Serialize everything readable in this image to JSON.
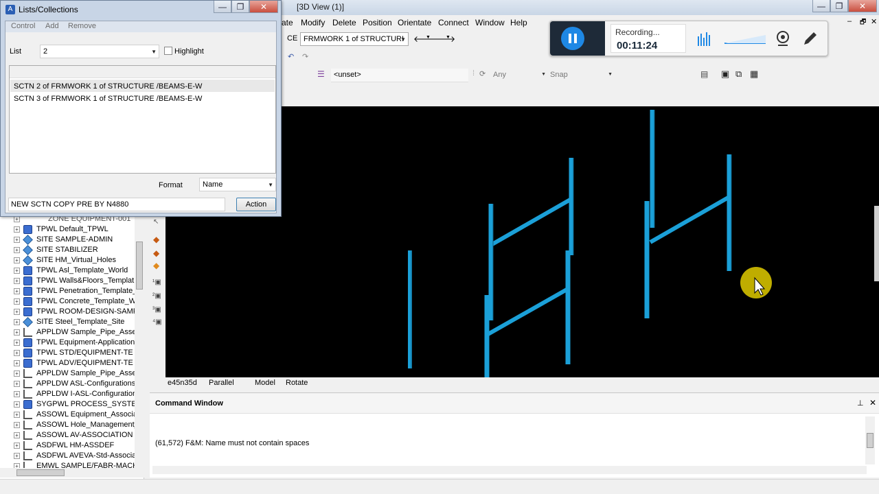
{
  "main_window": {
    "title": "[3D View (1)]",
    "controls": {
      "minimize": "—",
      "restore": "❐",
      "close": "✕"
    },
    "inner_controls": {
      "minimize": "–",
      "restore": "🗗",
      "close": "✕"
    }
  },
  "menu": [
    "ate",
    "Modify",
    "Delete",
    "Position",
    "Orientate",
    "Connect",
    "Window",
    "Help"
  ],
  "toolbar": {
    "ce_label": "CE",
    "ce_value": "FRMWORK 1 of STRUCTURI",
    "unset_value": "<unset>",
    "any_value": "Any",
    "snap_value": "Snap"
  },
  "recording": {
    "status": "Recording...",
    "time": "00:11:24",
    "accent": "#1e88e5"
  },
  "view_status": {
    "direction": "e45n35d",
    "projection": "Parallel",
    "mode": "Model",
    "action": "Rotate"
  },
  "command_window": {
    "title": "Command Window",
    "message": "(61,572)  F&M: Name must not contain spaces",
    "pin_icon": "pin-icon",
    "close_icon": "close-icon"
  },
  "dialog": {
    "title": "Lists/Collections",
    "menu": {
      "control": "Control",
      "add": "Add",
      "remove": "Remove"
    },
    "list_label": "List",
    "list_value": "2",
    "highlight_label": "Highlight",
    "items": [
      "SCTN 2 of FRMWORK 1 of STRUCTURE /BEAMS-E-W",
      "SCTN 3 of FRMWORK 1 of STRUCTURE /BEAMS-E-W"
    ],
    "format_label": "Format",
    "format_value": "Name",
    "command_text": "NEW SCTN COPY PRE BY N4880",
    "action_label": "Action",
    "controls": {
      "minimize": "—",
      "restore": "❐",
      "close": "✕"
    }
  },
  "tree": {
    "partial_top": "ZONE EQUIPMENT-001",
    "items": [
      {
        "label": "TPWL Default_TPWL",
        "icon": "world-icon"
      },
      {
        "label": "SITE SAMPLE-ADMIN",
        "icon": "site-icon"
      },
      {
        "label": "SITE STABILIZER",
        "icon": "site-icon"
      },
      {
        "label": "SITE HM_Virtual_Holes",
        "icon": "site-icon"
      },
      {
        "label": "TPWL Asl_Template_World",
        "icon": "world-icon"
      },
      {
        "label": "TPWL Walls&Floors_Templat",
        "icon": "world-icon"
      },
      {
        "label": "TPWL Penetration_Template_",
        "icon": "world-icon"
      },
      {
        "label": "TPWL Concrete_Template_W",
        "icon": "world-icon"
      },
      {
        "label": "TPWL ROOM-DESIGN-SAMP",
        "icon": "world-icon"
      },
      {
        "label": "SITE Steel_Template_Site",
        "icon": "site-icon"
      },
      {
        "label": "APPLDW Sample_Pipe_Asse",
        "icon": "network-icon"
      },
      {
        "label": "TPWL Equipment-Application-",
        "icon": "world-icon"
      },
      {
        "label": "TPWL STD/EQUIPMENT-TE",
        "icon": "world-icon"
      },
      {
        "label": "TPWL ADV/EQUIPMENT-TE",
        "icon": "world-icon"
      },
      {
        "label": "APPLDW Sample_Pipe_Asse",
        "icon": "network-icon"
      },
      {
        "label": "APPLDW ASL-Configurations-",
        "icon": "network-icon"
      },
      {
        "label": "APPLDW I-ASL-Configuration",
        "icon": "network-icon"
      },
      {
        "label": "SYGPWL PROCESS_SYSTE",
        "icon": "world-icon"
      },
      {
        "label": "ASSOWL Equipment_Associa",
        "icon": "network-icon"
      },
      {
        "label": "ASSOWL Hole_Management_",
        "icon": "network-icon"
      },
      {
        "label": "ASSOWL AV-ASSOCIATION",
        "icon": "network-icon"
      },
      {
        "label": "ASDFWL HM-ASSDEF",
        "icon": "network-icon"
      },
      {
        "label": "ASDFWL AVEVA-Std-Associa",
        "icon": "network-icon"
      },
      {
        "label": "EMWL SAMPLE/FABR-MACH",
        "icon": "network-icon"
      }
    ]
  },
  "colors": {
    "beam": "#1ba0d8",
    "viewport_bg": "#000000",
    "cursor_highlight": "#d4c000"
  }
}
